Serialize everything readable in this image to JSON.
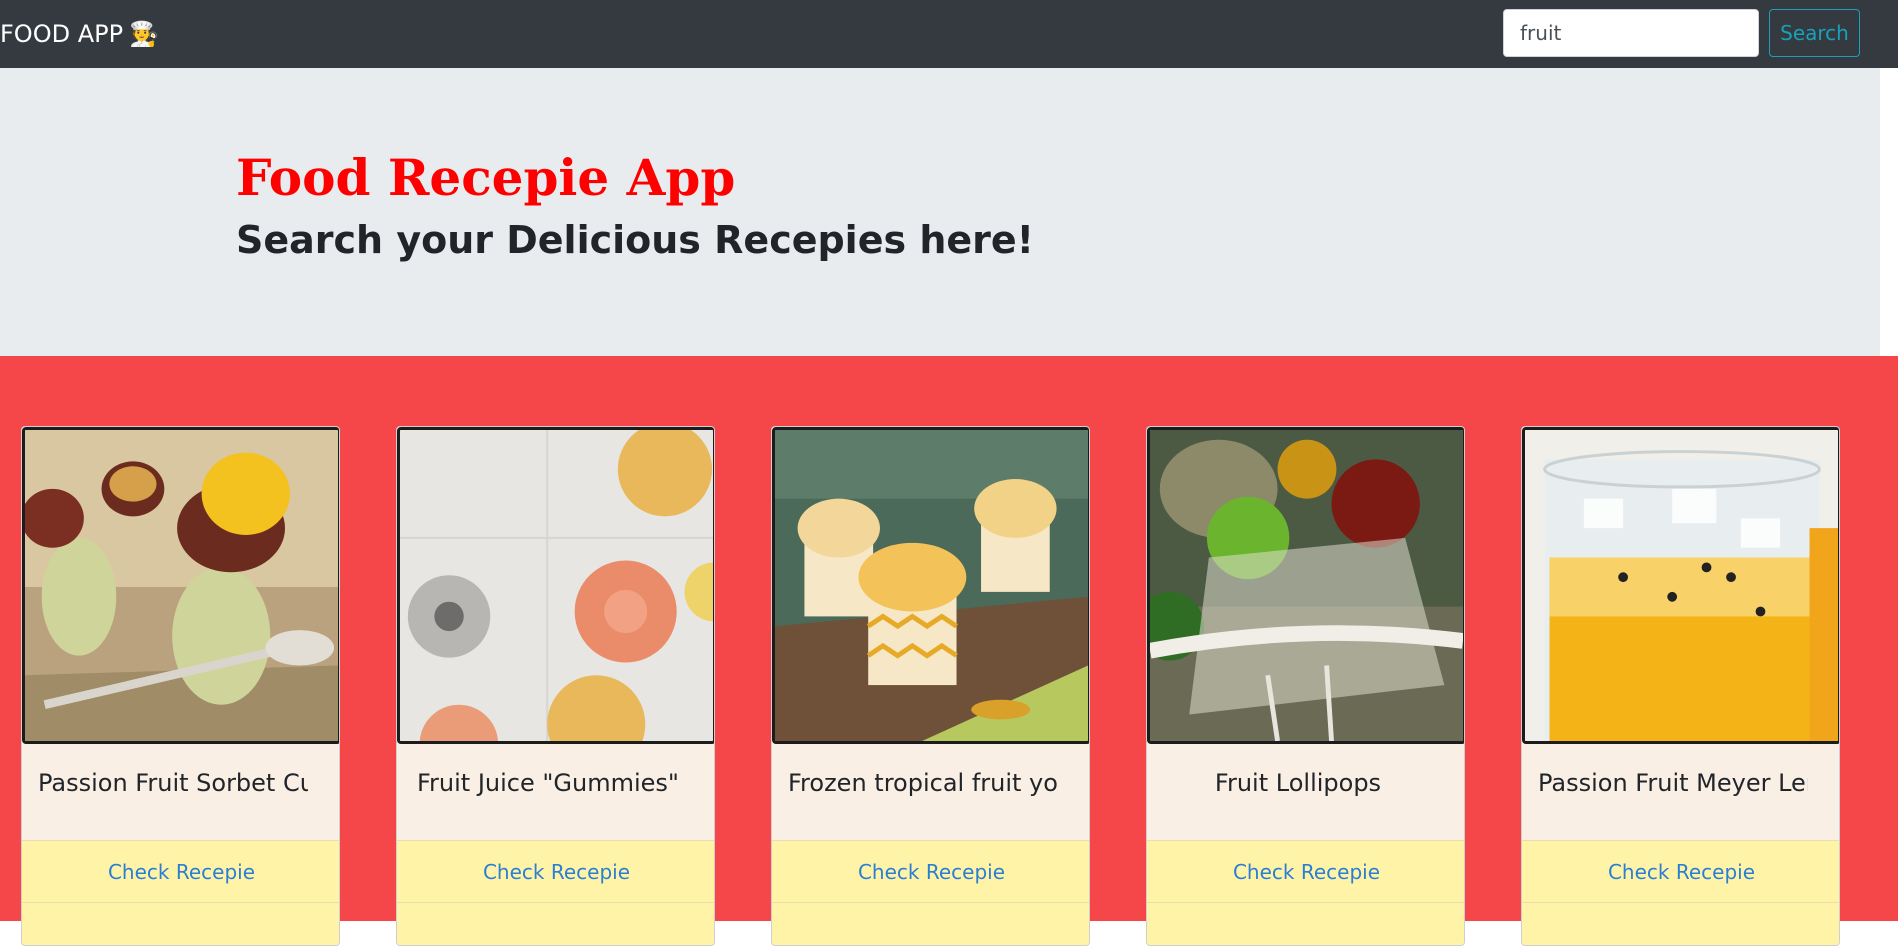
{
  "navbar": {
    "brand": "FOOD APP",
    "brand_emoji": "🧑‍🍳",
    "search_value": "fruit",
    "search_button": "Search"
  },
  "hero": {
    "title": "Food Recepie App",
    "subtitle": "Search your Delicious Recepies here!"
  },
  "cards": [
    {
      "title": "Passion Fruit Sorbet Cups",
      "link": "Check Recepie"
    },
    {
      "title": "Fruit Juice \"Gummies\"",
      "link": "Check Recepie"
    },
    {
      "title": "Frozen tropical fruit yogurt",
      "link": "Check Recepie"
    },
    {
      "title": "Fruit Lollipops",
      "link": "Check Recepie"
    },
    {
      "title": "Passion Fruit Meyer Lemonade",
      "link": "Check Recepie"
    }
  ],
  "colors": {
    "navbar": "#343a40",
    "hero_title": "#ff0000",
    "results_bg": "#f5474a",
    "card_footer": "#fff3a8",
    "link": "#2a7fd4",
    "search_outline": "#17a2b8"
  }
}
